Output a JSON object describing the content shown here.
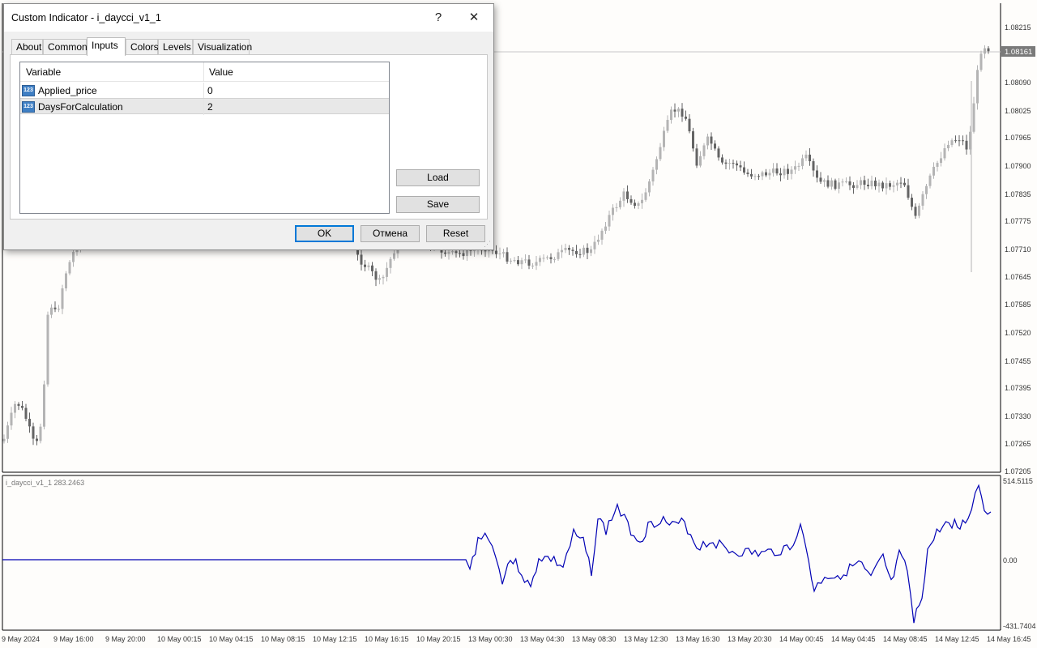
{
  "dialog": {
    "title": "Custom Indicator - i_daycci_v1_1",
    "help_label": "?",
    "close_label": "✕",
    "tabs": [
      {
        "label": "About"
      },
      {
        "label": "Common"
      },
      {
        "label": "Inputs"
      },
      {
        "label": "Colors"
      },
      {
        "label": "Levels"
      },
      {
        "label": "Visualization"
      }
    ],
    "active_tab": "Inputs",
    "grid": {
      "headers": [
        "Variable",
        "Value"
      ],
      "icon_text": "123",
      "rows": [
        {
          "variable": "Applied_price",
          "value": "0"
        },
        {
          "variable": "DaysForCalculation",
          "value": "2"
        }
      ]
    },
    "buttons": {
      "load": "Load",
      "save": "Save",
      "ok": "OK",
      "cancel": "Отмена",
      "reset": "Reset"
    }
  },
  "price_axis": {
    "labels": [
      "1.08215",
      "1.08090",
      "1.08025",
      "1.07965",
      "1.07900",
      "1.07835",
      "1.07775",
      "1.07710",
      "1.07645",
      "1.07585",
      "1.07520",
      "1.07455",
      "1.07395",
      "1.07330",
      "1.07265",
      "1.07205"
    ],
    "current_price": "1.08161"
  },
  "indicator": {
    "label": "i_daycci_v1_1 283.2463",
    "axis_labels": [
      "514.5115",
      "0.00",
      "-431.7404"
    ],
    "line_color": "#0000b4"
  },
  "time_axis": {
    "labels": [
      "9 May 2024",
      "9 May 16:00",
      "9 May 20:00",
      "10 May 00:15",
      "10 May 04:15",
      "10 May 08:15",
      "10 May 12:15",
      "10 May 16:15",
      "10 May 20:15",
      "13 May 00:30",
      "13 May 04:30",
      "13 May 08:30",
      "13 May 12:30",
      "13 May 16:30",
      "13 May 20:30",
      "14 May 00:45",
      "14 May 04:45",
      "14 May 08:45",
      "14 May 12:45",
      "14 May 16:45"
    ]
  },
  "colors": {
    "bull_candle": "#b4b4b4",
    "bear_candle": "#646464",
    "background": "#fefdfb",
    "dialog_default_border": "#0078d7"
  }
}
